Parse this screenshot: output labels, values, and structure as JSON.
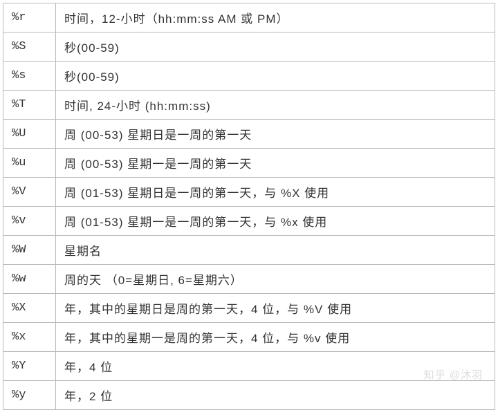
{
  "rows": [
    {
      "code": "%r",
      "desc": "时间，12-小时（hh:mm:ss AM 或 PM）"
    },
    {
      "code": "%S",
      "desc": "秒(00-59)"
    },
    {
      "code": "%s",
      "desc": "秒(00-59)"
    },
    {
      "code": "%T",
      "desc": "时间, 24-小时 (hh:mm:ss)"
    },
    {
      "code": "%U",
      "desc": "周 (00-53) 星期日是一周的第一天"
    },
    {
      "code": "%u",
      "desc": "周 (00-53) 星期一是一周的第一天"
    },
    {
      "code": "%V",
      "desc": "周 (01-53) 星期日是一周的第一天，与 %X 使用"
    },
    {
      "code": "%v",
      "desc": "周 (01-53) 星期一是一周的第一天，与 %x 使用"
    },
    {
      "code": "%W",
      "desc": "星期名"
    },
    {
      "code": "%w",
      "desc": "周的天 （0=星期日, 6=星期六）"
    },
    {
      "code": "%X",
      "desc": "年，其中的星期日是周的第一天，4 位，与 %V 使用"
    },
    {
      "code": "%x",
      "desc": "年，其中的星期一是周的第一天，4 位，与 %v 使用"
    },
    {
      "code": "%Y",
      "desc": "年，4 位"
    },
    {
      "code": "%y",
      "desc": "年，2 位"
    }
  ],
  "watermark": "知乎 @沐羽"
}
